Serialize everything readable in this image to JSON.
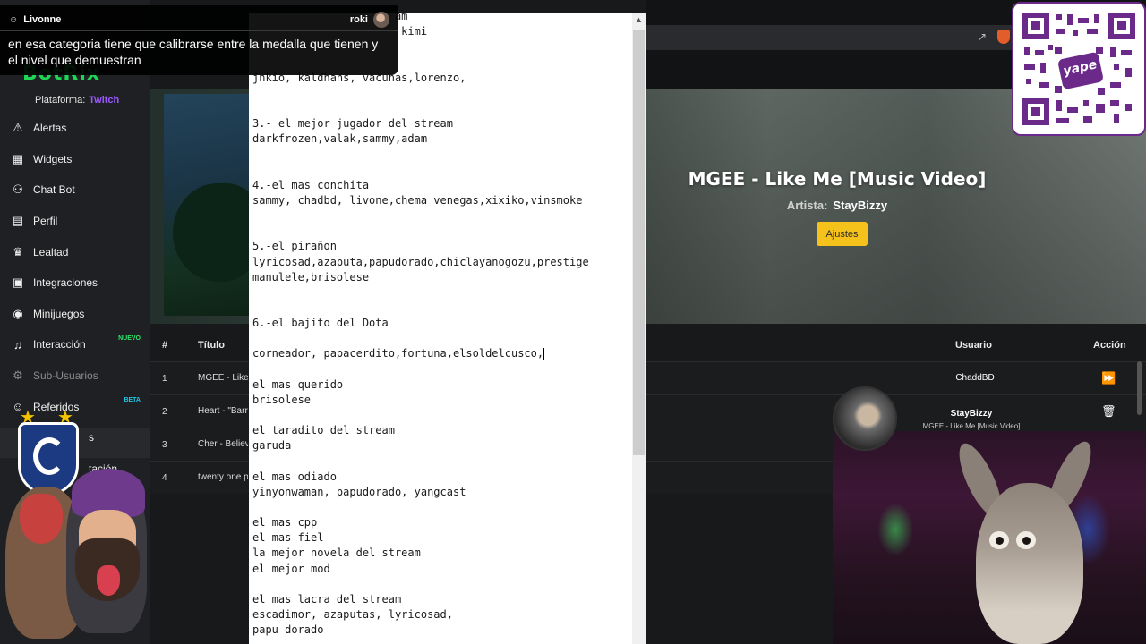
{
  "chat": {
    "username": "Livonne",
    "right_user": "roki",
    "message": "en esa categoria tiene que calibrarse entre la medalla que tienen y el nivel que demuestran"
  },
  "sidebar": {
    "brand": "BotRix",
    "platform_label": "Plataforma:",
    "platform_value": "Twitch",
    "items": [
      {
        "label": "Alertas",
        "icon": "warning-icon"
      },
      {
        "label": "Widgets",
        "icon": "grid-icon"
      },
      {
        "label": "Chat Bot",
        "icon": "robot-icon"
      },
      {
        "label": "Perfil",
        "icon": "id-card-icon"
      },
      {
        "label": "Lealtad",
        "icon": "trophy-icon"
      },
      {
        "label": "Integraciones",
        "icon": "plug-icon"
      },
      {
        "label": "Minijuegos",
        "icon": "gamepad-icon"
      },
      {
        "label": "Interacción",
        "icon": "music-icon",
        "badge": "NUEVO"
      },
      {
        "label": "Sub-Usuarios",
        "icon": "gear-icon"
      },
      {
        "label": "Referidos",
        "icon": "users-icon",
        "badge": "BETA"
      }
    ],
    "partial_items": [
      "s",
      "tación"
    ]
  },
  "player": {
    "title": "MGEE - Like Me [Music Video]",
    "artist_label": "Artista:",
    "artist": "StayBizzy",
    "settings_button": "Ajustes"
  },
  "table": {
    "headers": {
      "num": "#",
      "title": "Título",
      "user": "Usuario",
      "action": "Acción"
    },
    "rows": [
      {
        "num": "1",
        "title": "MGEE - Like",
        "user": "ChaddBD",
        "action": "play-next-icon"
      },
      {
        "num": "2",
        "title": "Heart - \"Barr",
        "user": "",
        "action": "trash-icon"
      },
      {
        "num": "3",
        "title": "Cher - Believ",
        "user": "",
        "action": ""
      },
      {
        "num": "4",
        "title": "twenty one p",
        "user": "",
        "action": ""
      }
    ]
  },
  "now_playing": {
    "user": "StayBizzy",
    "song": "MGEE - Like Me [Music Video]"
  },
  "qr": {
    "brand": "yape"
  },
  "notepad": {
    "text_before_caret": "                      am\n                       kimi\n\n\njnkio, kaldhans, vacunas,lorenzo,\n\n\n3.- el mejor jugador del stream\ndarkfrozen,valak,sammy,adam\n\n\n4.-el mas conchita\nsammy, chadbd, livone,chema venegas,xixiko,vinsmoke\n\n\n5.-el pirañon\nlyricosad,azaputa,papudorado,chiclayanogozu,prestige\nmanulele,brisolese\n\n\n6.-el bajito del Dota\n\ncorneador, papacerdito,fortuna,elsoldelcusco,",
    "text_after_caret": "\n\nel mas querido\nbrisolese\n\nel taradito del stream\ngaruda\n\nel mas odiado\nyinyonwaman, papudorado, yangcast\n\nel mas cpp\nel mas fiel\nla mejor novela del stream\nel mejor mod\n\nel mas lacra del stream\nescadimor, azaputas, lyricosad,\npapu dorado"
  }
}
